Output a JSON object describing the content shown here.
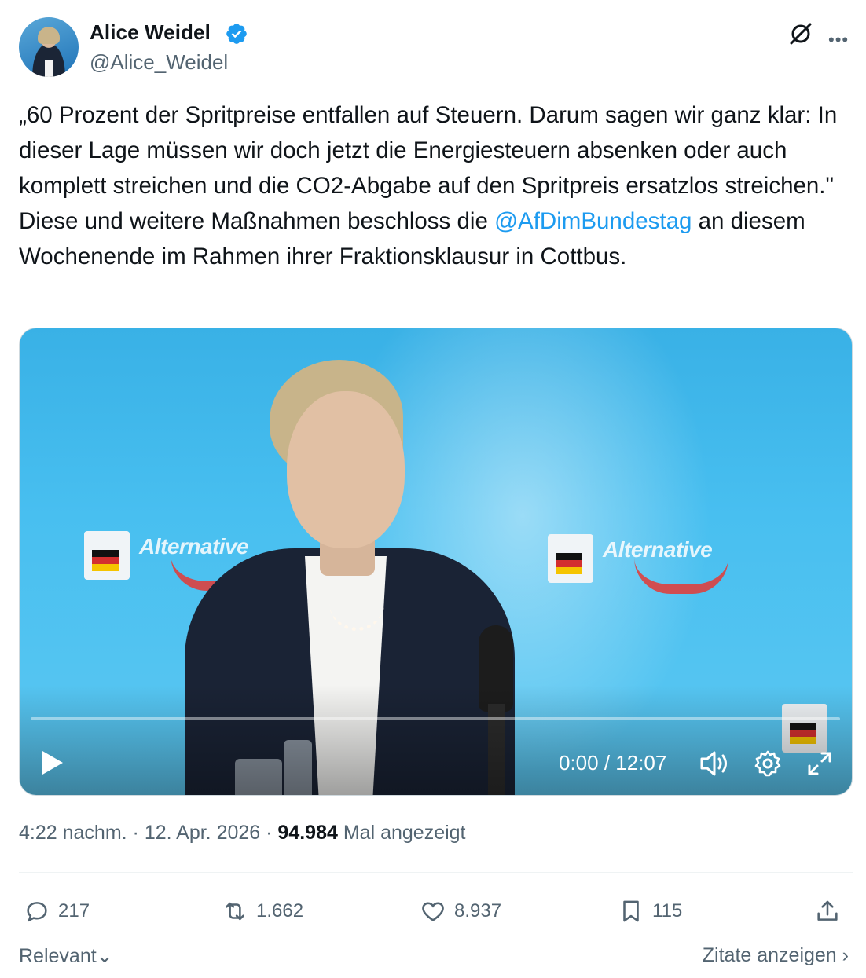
{
  "author": {
    "name": "Alice Weidel",
    "handle": "@Alice_Weidel"
  },
  "icons": {
    "verified": "verified-badge-icon",
    "grok": "grok-icon",
    "more": "more-icon"
  },
  "tweet": {
    "text_before": "„60 Prozent der Spritpreise entfallen auf Steuern. Darum sagen wir ganz klar: In dieser Lage müssen wir doch jetzt die Energiesteuern absenken oder auch komplett streichen und die CO2-Abgabe auf den Spritpreis ersatzlos streichen.\" Diese und weitere Maßnahmen beschloss die ",
    "mention": "@AfDimBundestag",
    "text_after": " an diesem Wochenende im Rahmen ihrer Fraktionsklausur in Cottbus."
  },
  "video": {
    "current_time": "0:00",
    "duration": "12:07",
    "time_display": "0:00 / 12:07",
    "progress": 0,
    "logo_text": "Alternative"
  },
  "meta": {
    "time": "4:22 nachm.",
    "date": "12. Apr. 2026",
    "views": "94.984",
    "views_label": "Mal angezeigt",
    "separator": "·"
  },
  "actions": {
    "replies": "217",
    "reposts": "1.662",
    "likes": "8.937",
    "bookmarks": "115"
  },
  "footer": {
    "sort_label": "Relevant",
    "quotes_link": "Zitate anzeigen"
  },
  "colors": {
    "accent": "#1d9bf0",
    "text": "#0f1419",
    "muted": "#536471"
  }
}
